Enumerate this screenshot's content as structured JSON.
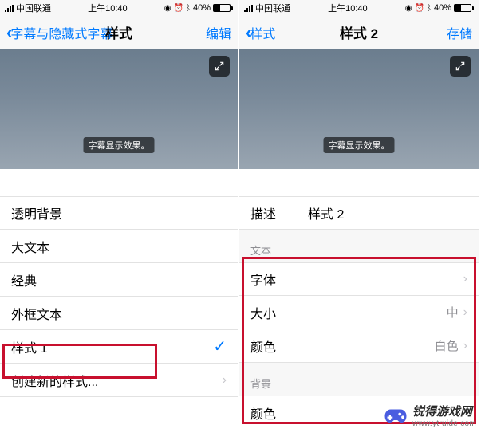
{
  "status": {
    "carrier": "中国联通",
    "time": "上午10:40",
    "battery_pct": "40%",
    "alarm_icon": "⏰",
    "bt_icon": "ᛒ",
    "lock_icon": "◉"
  },
  "left": {
    "nav": {
      "back": "字幕与隐藏式字幕",
      "title": "样式",
      "action": "编辑"
    },
    "preview_caption": "字幕显示效果。",
    "rows": [
      {
        "label": "透明背景"
      },
      {
        "label": "大文本"
      },
      {
        "label": "经典"
      },
      {
        "label": "外框文本"
      },
      {
        "label": "样式 1",
        "checked": true
      },
      {
        "label": "创建新的样式...",
        "disclosure": true
      }
    ]
  },
  "right": {
    "nav": {
      "back": "样式",
      "title": "样式 2",
      "action": "存储"
    },
    "preview_caption": "字幕显示效果。",
    "describe": {
      "label": "描述",
      "value": "样式 2"
    },
    "section_text": "文本",
    "text_rows": [
      {
        "label": "字体",
        "value": "",
        "disclosure": true
      },
      {
        "label": "大小",
        "value": "中",
        "disclosure": true
      },
      {
        "label": "颜色",
        "value": "白色",
        "disclosure": true
      }
    ],
    "section_bg": "背景",
    "bg_rows": [
      {
        "label": "颜色",
        "value": "",
        "disclosure": false
      }
    ]
  },
  "watermark": {
    "brand": "锐得游戏网",
    "url": "www.ytruide.com"
  }
}
